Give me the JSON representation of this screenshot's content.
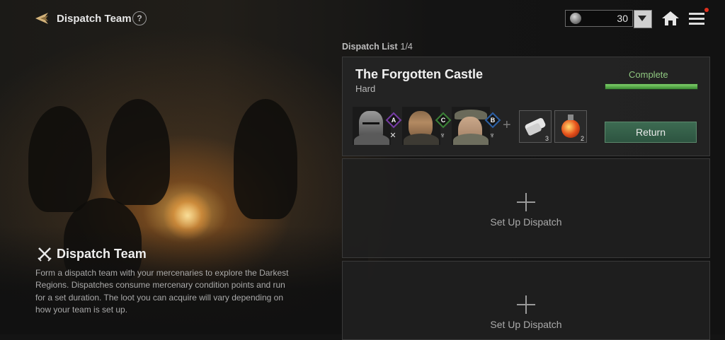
{
  "header": {
    "title": "Dispatch Team",
    "help_label": "?",
    "currency_amount": "30",
    "back_icon": "back-arrow-icon",
    "home_icon": "home-icon",
    "menu_icon": "hamburger-menu-icon"
  },
  "intro": {
    "title": "Dispatch Team",
    "description": "Form a dispatch team with your mercenaries to explore the Darkest Regions. Dispatches consume mercenary condition points and run for a set duration. The loot you can acquire will vary depending on how your team is set up."
  },
  "dispatch_list": {
    "label": "Dispatch List",
    "count": "1/4",
    "active": {
      "name": "The Forgotten Castle",
      "difficulty": "Hard",
      "status": "Complete",
      "progress": 1.0,
      "return_label": "Return",
      "mercenaries": [
        {
          "rank": "A",
          "rank_color": "#7d3fb0",
          "role_icon": "crossed-swords-icon",
          "role_glyph": "✕"
        },
        {
          "rank": "C",
          "rank_color": "#3f8a3a",
          "role_icon": "dagger-icon",
          "role_glyph": "♆"
        },
        {
          "rank": "B",
          "rank_color": "#2f66b0",
          "role_icon": "dagger-icon",
          "role_glyph": "♆"
        }
      ],
      "loot": [
        {
          "icon": "bandage-icon",
          "qty": "3"
        },
        {
          "icon": "potion-icon",
          "qty": "2"
        }
      ]
    },
    "empty_slot_label": "Set Up Dispatch",
    "empty_slot_label_2": "Set Up Dispatch"
  },
  "colors": {
    "accent_green": "#8fc880",
    "return_button": "#3d6b52",
    "notification": "#e0301e"
  }
}
